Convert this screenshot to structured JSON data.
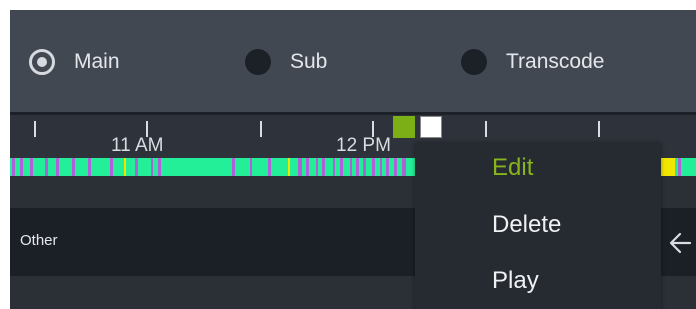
{
  "stream_options": [
    {
      "label": "Main",
      "selected": true
    },
    {
      "label": "Sub",
      "selected": false
    },
    {
      "label": "Transcode",
      "selected": false
    }
  ],
  "timeline": {
    "labels": [
      "11 AM",
      "12 PM"
    ]
  },
  "recording_colors": {
    "continuous": "#23ef99",
    "motion": "#b060d8",
    "alarm": "#f2e600",
    "gap": "#2b2f36"
  },
  "channel_row": {
    "label": "Other",
    "back_icon": "arrow-left-icon"
  },
  "context_menu": {
    "items": [
      {
        "label": "Edit",
        "active": true
      },
      {
        "label": "Delete",
        "active": false
      },
      {
        "label": "Play",
        "active": false
      }
    ]
  },
  "colors": {
    "accent": "#86b51c",
    "panel_bg": "#424852",
    "row_bg": "#1b1f26"
  }
}
